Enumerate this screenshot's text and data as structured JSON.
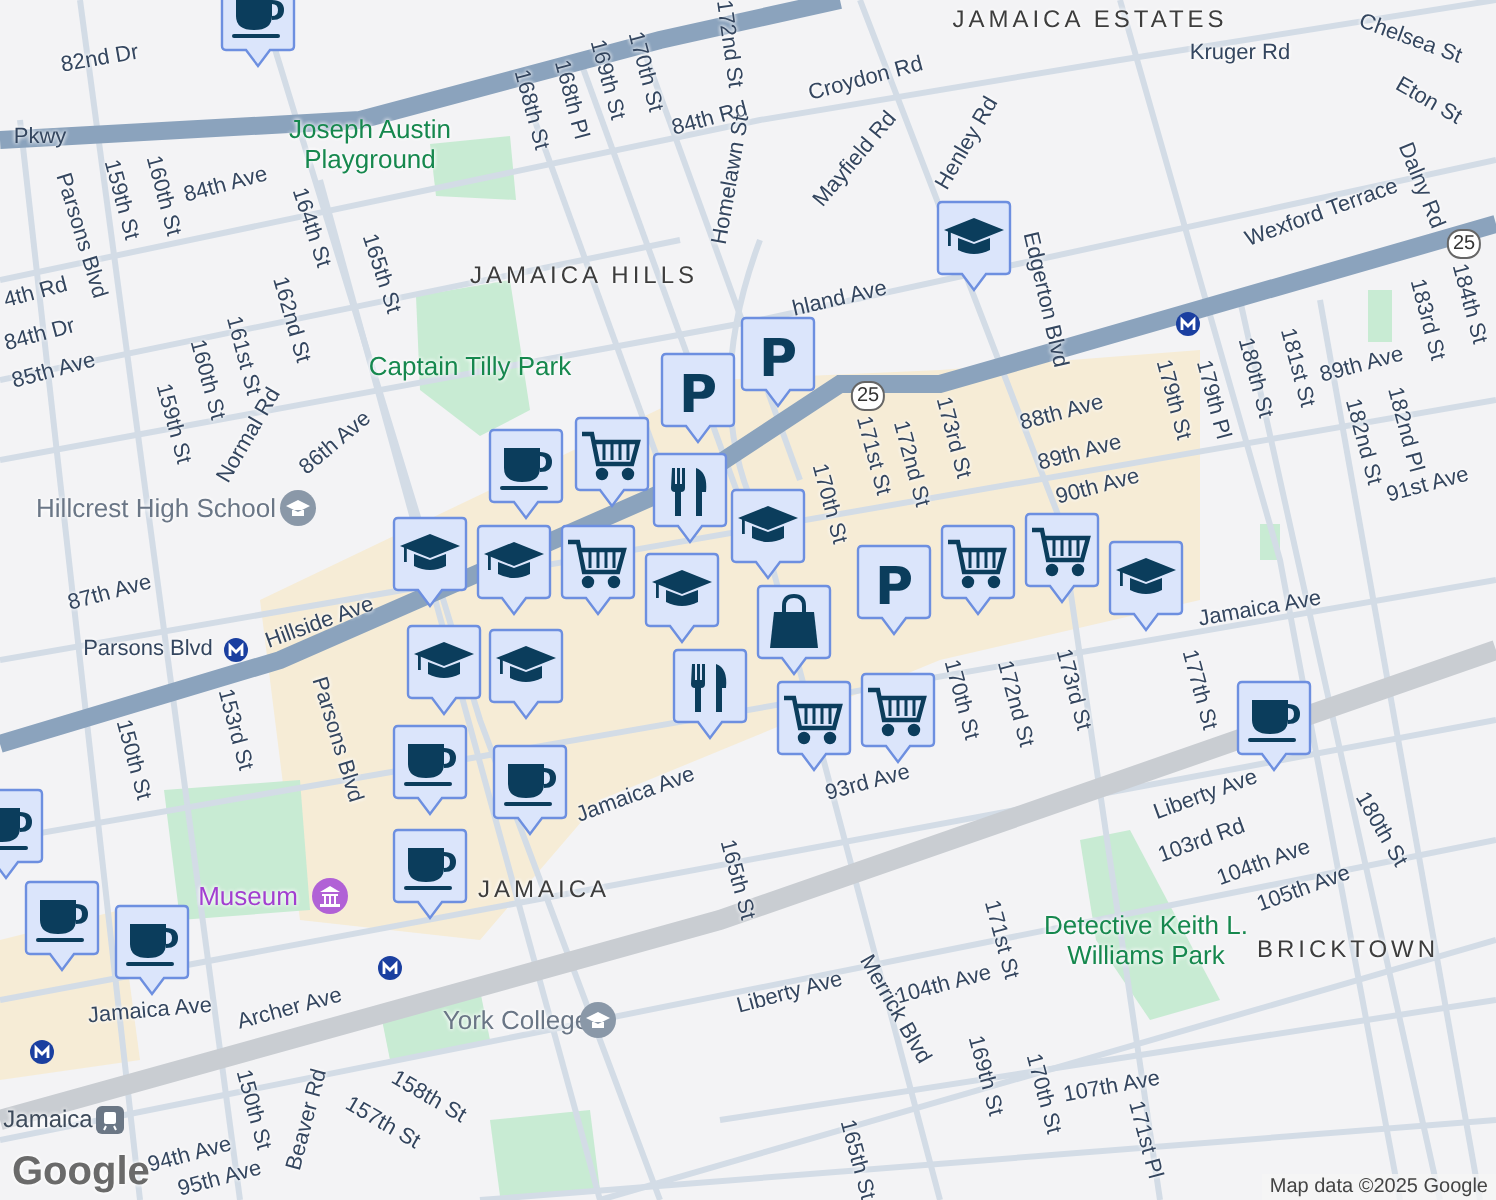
{
  "map": {
    "labels": [
      {
        "kind": "street",
        "text": "82nd Dr"
      },
      {
        "kind": "street",
        "text": "Pkwy"
      },
      {
        "kind": "street",
        "text": "84th Ave"
      },
      {
        "kind": "street",
        "text": "Parsons Blvd"
      },
      {
        "kind": "street",
        "text": "159th St"
      },
      {
        "kind": "street",
        "text": "160th St"
      },
      {
        "kind": "street",
        "text": "164th St"
      },
      {
        "kind": "street",
        "text": "165th St"
      },
      {
        "kind": "street",
        "text": "162nd St"
      },
      {
        "kind": "street",
        "text": "161st St"
      },
      {
        "kind": "street",
        "text": "160th St"
      },
      {
        "kind": "street",
        "text": "159th St"
      },
      {
        "kind": "street",
        "text": "Normal Rd"
      },
      {
        "kind": "street",
        "text": "86th Ave"
      },
      {
        "kind": "street",
        "text": "85th Ave"
      },
      {
        "kind": "street",
        "text": "84th Dr"
      },
      {
        "kind": "street",
        "text": "4th Rd"
      },
      {
        "kind": "street",
        "text": "87th Ave"
      },
      {
        "kind": "street",
        "text": "168th St"
      },
      {
        "kind": "street",
        "text": "168th Pl"
      },
      {
        "kind": "street",
        "text": "169th St"
      },
      {
        "kind": "street",
        "text": "170th St"
      },
      {
        "kind": "street",
        "text": "172nd St"
      },
      {
        "kind": "street",
        "text": "84th Rd"
      },
      {
        "kind": "street",
        "text": "Homelawn St"
      },
      {
        "kind": "street",
        "text": "Croydon Rd"
      },
      {
        "kind": "street",
        "text": "Mayfield Rd"
      },
      {
        "kind": "street",
        "text": "Henley Rd"
      },
      {
        "kind": "street",
        "text": "Kruger Rd"
      },
      {
        "kind": "street",
        "text": "Chelsea St"
      },
      {
        "kind": "street",
        "text": "Eton St"
      },
      {
        "kind": "street",
        "text": "Dalny Rd"
      },
      {
        "kind": "street",
        "text": "Wexford Terrace"
      },
      {
        "kind": "street",
        "text": "Edgerton Blvd"
      },
      {
        "kind": "street",
        "text": "hland Ave"
      },
      {
        "kind": "street",
        "text": "179th St"
      },
      {
        "kind": "street",
        "text": "179th Pl"
      },
      {
        "kind": "street",
        "text": "180th St"
      },
      {
        "kind": "street",
        "text": "181st St"
      },
      {
        "kind": "street",
        "text": "182nd St"
      },
      {
        "kind": "street",
        "text": "182nd Pl"
      },
      {
        "kind": "street",
        "text": "183rd St"
      },
      {
        "kind": "street",
        "text": "184th St"
      },
      {
        "kind": "street",
        "text": "89th Ave"
      },
      {
        "kind": "street",
        "text": "91st Ave"
      },
      {
        "kind": "street",
        "text": "88th Ave"
      },
      {
        "kind": "street",
        "text": "89th Ave"
      },
      {
        "kind": "street",
        "text": "90th Ave"
      },
      {
        "kind": "street",
        "text": "173rd St"
      },
      {
        "kind": "street",
        "text": "172nd St"
      },
      {
        "kind": "street",
        "text": "171st St"
      },
      {
        "kind": "street",
        "text": "170th St"
      },
      {
        "kind": "area",
        "text": "JAMAICA ESTATES"
      },
      {
        "kind": "area",
        "text": "JAMAICA HILLS"
      },
      {
        "kind": "area",
        "text": "BRICKTOWN"
      },
      {
        "kind": "area",
        "text": "JAMAICA"
      },
      {
        "kind": "park",
        "text": "Joseph Austin Playground"
      },
      {
        "kind": "park",
        "text": "Captain Tilly Park"
      },
      {
        "kind": "park",
        "text": "Detective Keith L. Williams Park"
      },
      {
        "kind": "poi",
        "text": "Hillcrest High School"
      },
      {
        "kind": "poi",
        "text": "York College"
      },
      {
        "kind": "museum",
        "text": "Museum"
      },
      {
        "kind": "street",
        "text": "Parsons Blvd"
      },
      {
        "kind": "street",
        "text": "Hillside Ave"
      },
      {
        "kind": "street",
        "text": "Parsons Blvd"
      },
      {
        "kind": "street",
        "text": "150th St"
      },
      {
        "kind": "street",
        "text": "153rd St"
      },
      {
        "kind": "street",
        "text": "Jamaica Ave"
      },
      {
        "kind": "street",
        "text": "Archer Ave"
      },
      {
        "kind": "street",
        "text": "150th St"
      },
      {
        "kind": "street",
        "text": "Beaver Rd"
      },
      {
        "kind": "street",
        "text": "158th St"
      },
      {
        "kind": "street",
        "text": "157th St"
      },
      {
        "kind": "street",
        "text": "94th Ave"
      },
      {
        "kind": "street",
        "text": "95th Ave"
      },
      {
        "kind": "street",
        "text": "Jamaica Ave"
      },
      {
        "kind": "street",
        "text": "Liberty Ave"
      },
      {
        "kind": "street",
        "text": "165th St"
      },
      {
        "kind": "street",
        "text": "Merrick Blvd"
      },
      {
        "kind": "street",
        "text": "104th Ave"
      },
      {
        "kind": "street",
        "text": "171st St"
      },
      {
        "kind": "street",
        "text": "169th St"
      },
      {
        "kind": "street",
        "text": "170th St"
      },
      {
        "kind": "street",
        "text": "171st Pl"
      },
      {
        "kind": "street",
        "text": "107th Ave"
      },
      {
        "kind": "street",
        "text": "165th St"
      },
      {
        "kind": "street",
        "text": "Jamaica Ave"
      },
      {
        "kind": "street",
        "text": "170th St"
      },
      {
        "kind": "street",
        "text": "172nd St"
      },
      {
        "kind": "street",
        "text": "173rd St"
      },
      {
        "kind": "street",
        "text": "177th St"
      },
      {
        "kind": "street",
        "text": "93rd Ave"
      },
      {
        "kind": "street",
        "text": "Liberty Ave"
      },
      {
        "kind": "street",
        "text": "103rd Rd"
      },
      {
        "kind": "street",
        "text": "104th Ave"
      },
      {
        "kind": "street",
        "text": "105th Ave"
      },
      {
        "kind": "street",
        "text": "180th St"
      },
      {
        "kind": "station",
        "text": "Jamaica"
      },
      {
        "kind": "shield",
        "text": "25"
      },
      {
        "kind": "shield",
        "text": "25"
      }
    ],
    "markers": [
      {
        "kind": "coffee"
      },
      {
        "kind": "school"
      },
      {
        "kind": "parking",
        "glyph": "P"
      },
      {
        "kind": "parking",
        "glyph": "P"
      },
      {
        "kind": "cart"
      },
      {
        "kind": "food"
      },
      {
        "kind": "coffee"
      },
      {
        "kind": "school"
      },
      {
        "kind": "school"
      },
      {
        "kind": "cart"
      },
      {
        "kind": "school"
      },
      {
        "kind": "school"
      },
      {
        "kind": "school"
      },
      {
        "kind": "school"
      },
      {
        "kind": "cart"
      },
      {
        "kind": "school"
      },
      {
        "kind": "cart"
      },
      {
        "kind": "parking",
        "glyph": "P"
      },
      {
        "kind": "shopping"
      },
      {
        "kind": "food"
      },
      {
        "kind": "cart"
      },
      {
        "kind": "cart"
      },
      {
        "kind": "coffee"
      },
      {
        "kind": "coffee"
      },
      {
        "kind": "coffee"
      },
      {
        "kind": "coffee"
      },
      {
        "kind": "coffee"
      },
      {
        "kind": "coffee"
      },
      {
        "kind": "coffee"
      }
    ]
  },
  "logo": "Google",
  "attribution": "Map data ©2025 Google"
}
